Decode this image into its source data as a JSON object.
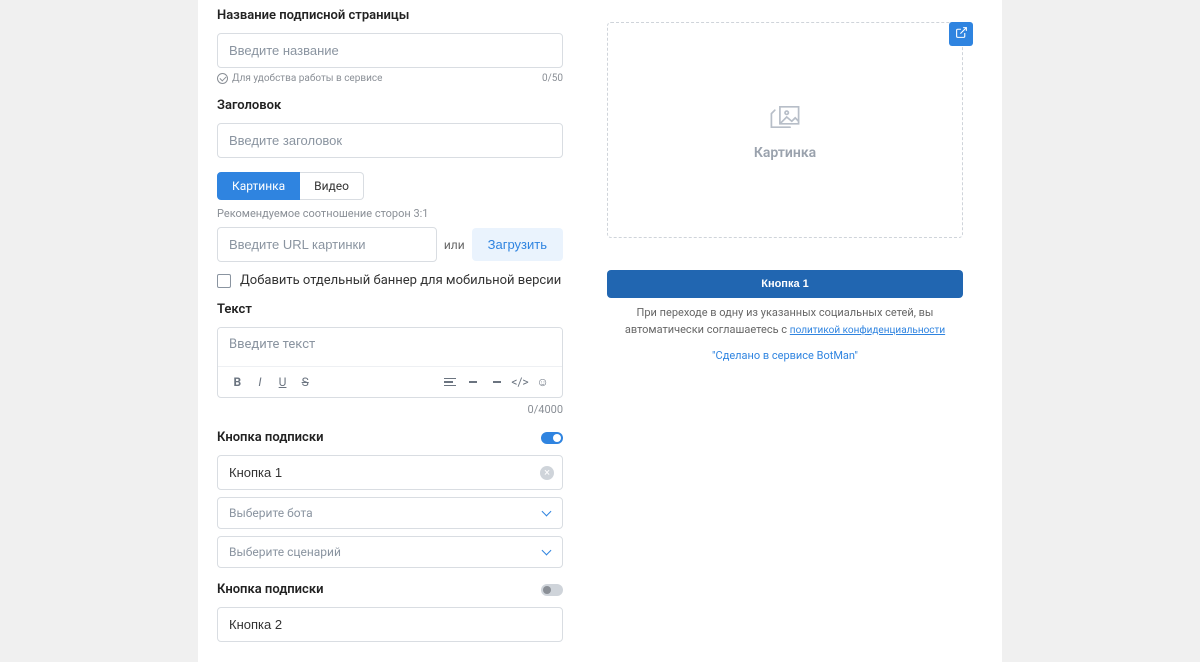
{
  "form": {
    "name": {
      "label": "Название подписной страницы",
      "placeholder": "Введите название",
      "hint": "Для удобства работы в сервисе",
      "counter": "0/50"
    },
    "heading": {
      "label": "Заголовок",
      "placeholder": "Введите заголовок"
    },
    "media": {
      "tabs": {
        "image": "Картинка",
        "video": "Видео"
      },
      "ratio_hint": "Рекомендуемое соотношение сторон 3:1",
      "url_placeholder": "Введите URL картинки",
      "or": "или",
      "upload": "Загрузить",
      "mobile_banner": "Добавить отдельный баннер для мобильной версии"
    },
    "text": {
      "label": "Текст",
      "placeholder": "Введите текст",
      "counter": "0/4000"
    },
    "button1": {
      "label": "Кнопка подписки",
      "value": "Кнопка 1",
      "select_bot": "Выберите бота",
      "select_scenario": "Выберите сценарий"
    },
    "button2": {
      "label": "Кнопка подписки",
      "value": "Кнопка 2"
    }
  },
  "preview": {
    "placeholder_label": "Картинка",
    "button_label": "Кнопка 1",
    "disclaimer_pre": "При переходе в одну из указанных социальных сетей, вы автоматически соглашаетесь с ",
    "privacy_link": "политикой конфиденциальности",
    "botman": "\"Сделано в сервисе BotMan\""
  }
}
